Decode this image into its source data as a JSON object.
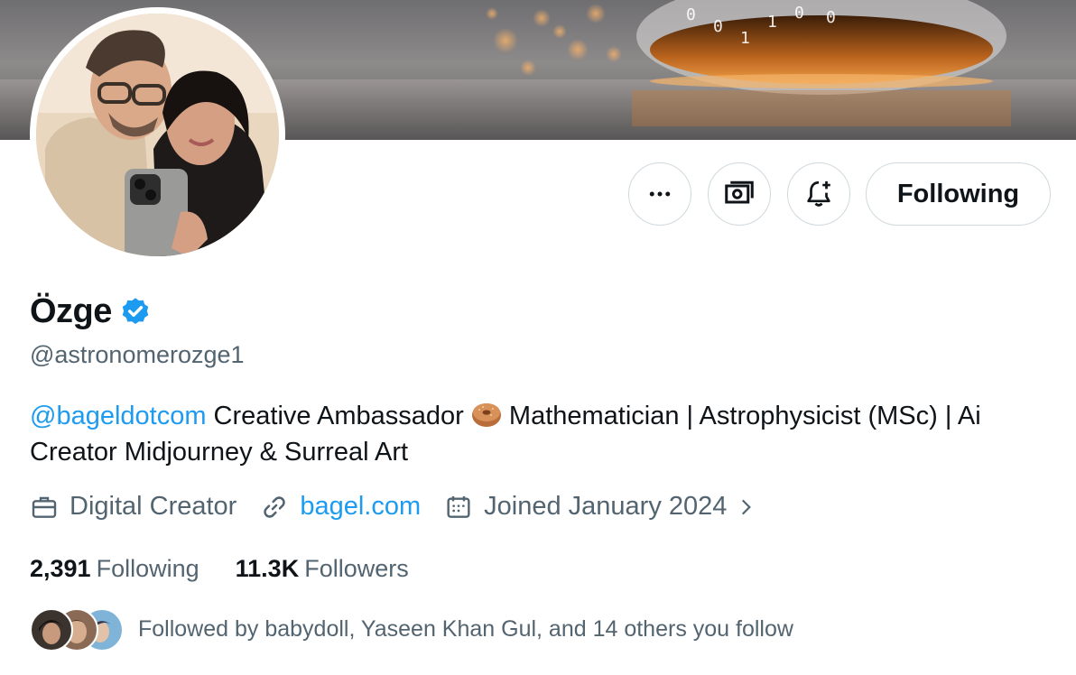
{
  "profile": {
    "display_name": "Özge",
    "handle": "@astronomerozge1",
    "verified_icon": "verified-badge-icon",
    "accent_color": "#1d9bf0"
  },
  "actions": {
    "more_icon": "more-dots-icon",
    "subscribe_icon": "money-icon",
    "notify_icon": "bell-plus-icon",
    "following_label": "Following"
  },
  "bio": {
    "mention": "@bageldotcom",
    "text_1": " Creative Ambassador ",
    "emoji": "bagel-emoji",
    "text_2": " Mathematician | Astrophysicist (MSc) | Ai Creator Midjourney & Surreal Art"
  },
  "meta": {
    "category": "Digital Creator",
    "website": "bagel.com",
    "joined": "Joined January 2024"
  },
  "stats": {
    "following_count": "2,391",
    "following_label": "Following",
    "followers_count": "11.3K",
    "followers_label": "Followers"
  },
  "followed_by": {
    "text": "Followed by babydoll, Yaseen Khan Gul, and 14 others you follow"
  }
}
